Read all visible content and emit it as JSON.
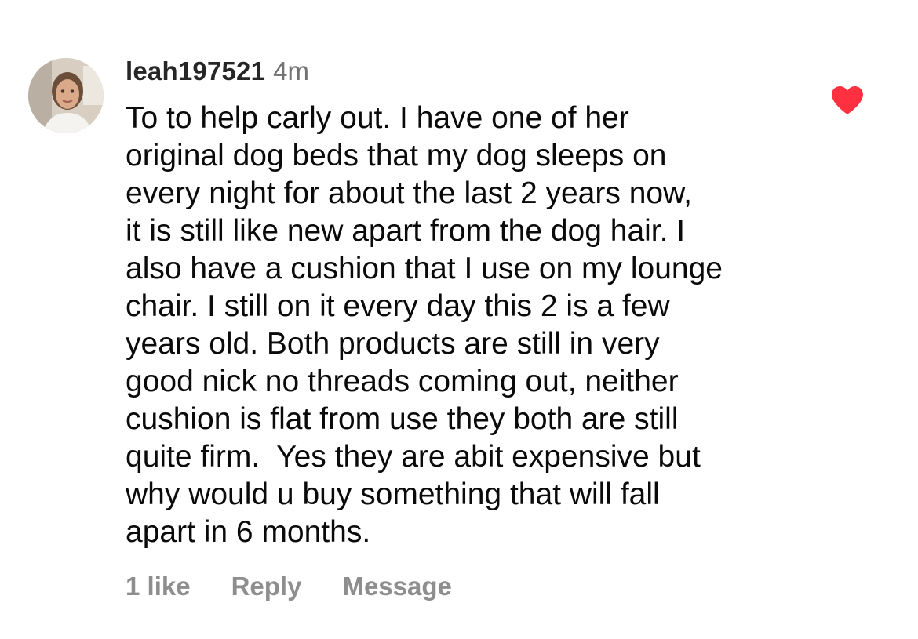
{
  "comment": {
    "username": "leah197521",
    "timestamp": "4m",
    "lines": [
      "To to help carly out. I have one of her",
      "original dog beds that my dog sleeps on",
      "every night for about the last 2 years now,",
      "it is still like new apart from the dog hair. I",
      "also have a cushion that I use on my lounge",
      "chair. I still on it every day this 2 is a few",
      "years old. Both products are still in very",
      "good nick no threads coming out, neither",
      "cushion is flat from use they both are still",
      "quite firm.  Yes they are abit expensive but",
      "why would u buy something that will fall",
      "apart in 6 months."
    ],
    "liked": true,
    "like_icon": "heart-filled-icon",
    "like_color": "#ff3040"
  },
  "actions": {
    "likes_label": "1 like",
    "reply_label": "Reply",
    "message_label": "Message"
  }
}
